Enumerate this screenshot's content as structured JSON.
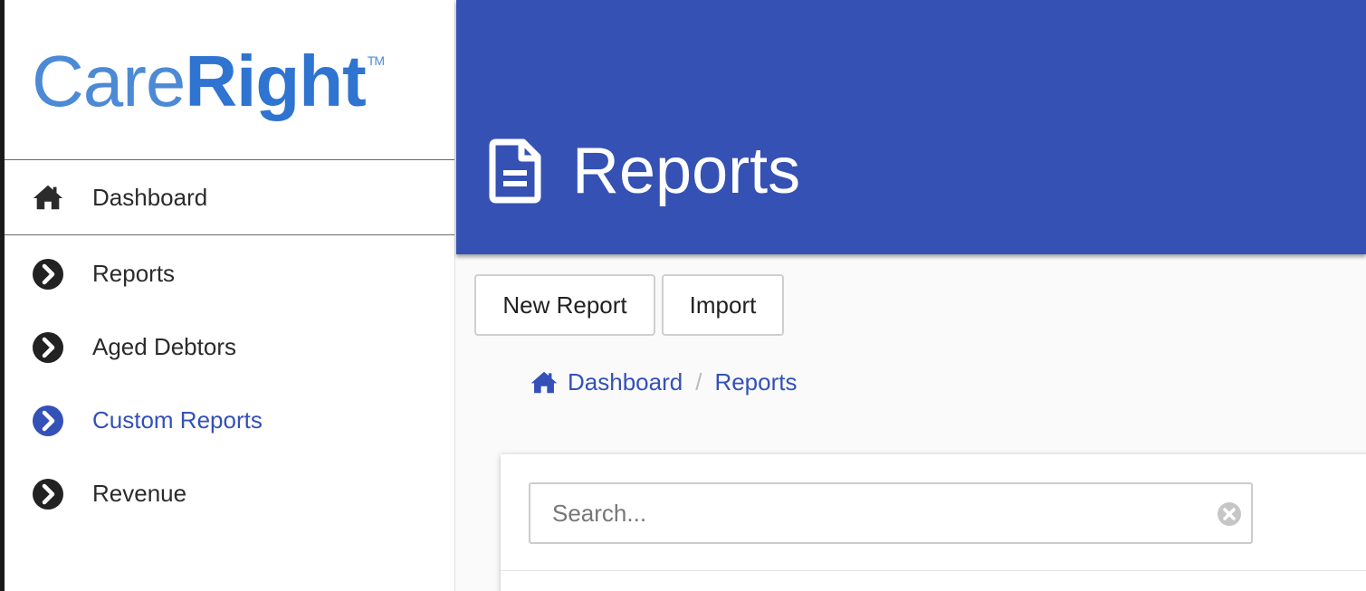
{
  "brand": {
    "logo_part1": "Care",
    "logo_part2": "Right",
    "trademark": "TM"
  },
  "sidebar": {
    "dashboard": {
      "label": "Dashboard",
      "icon": "home-icon"
    },
    "items": [
      {
        "label": "Reports",
        "icon": "chevron-circle-right-icon",
        "active": false
      },
      {
        "label": "Aged Debtors",
        "icon": "chevron-circle-right-icon",
        "active": false
      },
      {
        "label": "Custom Reports",
        "icon": "chevron-circle-right-icon",
        "active": true
      },
      {
        "label": "Revenue",
        "icon": "chevron-circle-right-icon",
        "active": false
      }
    ]
  },
  "header": {
    "title": "Reports",
    "icon": "file-text-icon"
  },
  "toolbar": {
    "new_report_label": "New Report",
    "import_label": "Import"
  },
  "breadcrumb": {
    "home": "Dashboard",
    "current": "Reports",
    "separator": "/"
  },
  "search": {
    "placeholder": "Search...",
    "value": ""
  },
  "colors": {
    "header": "#3551b4",
    "accent": "#3451b7",
    "logo": "#3f7fd2"
  }
}
